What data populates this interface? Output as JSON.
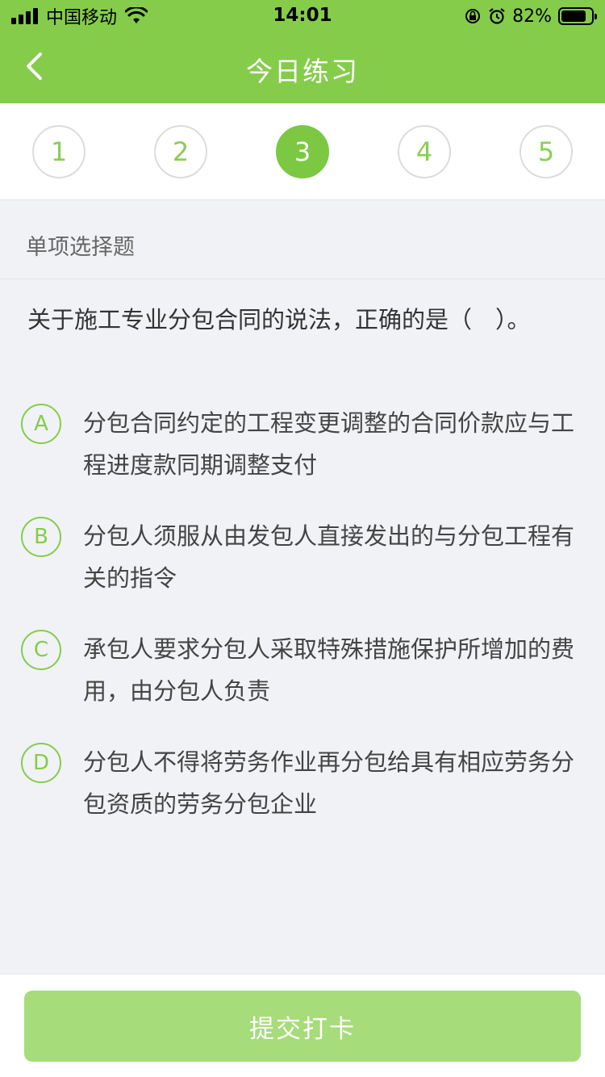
{
  "status_bar": {
    "carrier": "中国移动",
    "time": "14:01",
    "battery_pct": "82%",
    "icons": [
      "signal-icon",
      "wifi-icon",
      "rotation-lock-icon",
      "alarm-icon",
      "battery-icon"
    ]
  },
  "nav": {
    "title": "今日练习",
    "back_icon": "chevron-left-icon"
  },
  "question_numbers": [
    "1",
    "2",
    "3",
    "4",
    "5"
  ],
  "active_question": "3",
  "question_type": "单项选择题",
  "question_text": "关于施工专业分包合同的说法，正确的是（　）。",
  "options": [
    {
      "letter": "A",
      "text": "分包合同约定的工程变更调整的合同价款应与工程进度款同期调整支付"
    },
    {
      "letter": "B",
      "text": "分包人须服从由发包人直接发出的与分包工程有关的指令"
    },
    {
      "letter": "C",
      "text": "承包人要求分包人采取特殊措施保护所增加的费用，由分包人负责"
    },
    {
      "letter": "D",
      "text": "分包人不得将劳务作业再分包给具有相应劳务分包资质的劳务分包企业"
    }
  ],
  "submit_label": "提交打卡",
  "colors": {
    "brand_green": "#85cc4b",
    "active_number": "#7dc843",
    "submit_button": "#a6dc79",
    "background": "#f0f2f5"
  }
}
